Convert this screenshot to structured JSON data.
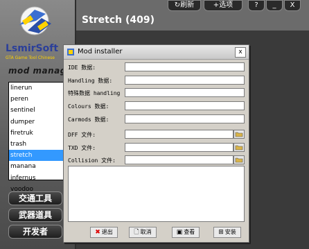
{
  "app": {
    "title": "Stretch (409)",
    "logo_title": "LsmirSoft",
    "logo_sub": "GTA Game Tool Chinese",
    "logo_tag": "mod manage",
    "top_buttons": [
      "刷新",
      "选项",
      "?",
      "_",
      "X"
    ],
    "side_buttons": [
      "交通工具",
      "武器道具",
      "开发者"
    ],
    "accent_color": "#3399ff"
  },
  "mod_list": {
    "items": [
      "linerun",
      "peren",
      "sentinel",
      "dumper",
      "firetruk",
      "trash",
      "stretch",
      "manana",
      "infernus",
      "voodoo"
    ],
    "selected": "stretch"
  },
  "dialog": {
    "title": "Mod installer",
    "close_label": "x",
    "fields": [
      {
        "label": "IDE 数据:",
        "value": ""
      },
      {
        "label": "Handling 数据:",
        "value": ""
      },
      {
        "label": "特殊数据 handling",
        "value": ""
      },
      {
        "label": "Colours 数据:",
        "value": ""
      },
      {
        "label": "Carmods 数据:",
        "value": ""
      }
    ],
    "files": [
      {
        "label": "DFF 文件:",
        "value": ""
      },
      {
        "label": "TXD 文件:",
        "value": ""
      },
      {
        "label": "Collision 文件:",
        "value": ""
      }
    ],
    "buttons": [
      {
        "label": "退出",
        "icon": "close-x-icon"
      },
      {
        "label": "取消",
        "icon": "document-icon"
      },
      {
        "label": "查看",
        "icon": "view-icon"
      },
      {
        "label": "安装",
        "icon": "install-icon"
      }
    ]
  }
}
